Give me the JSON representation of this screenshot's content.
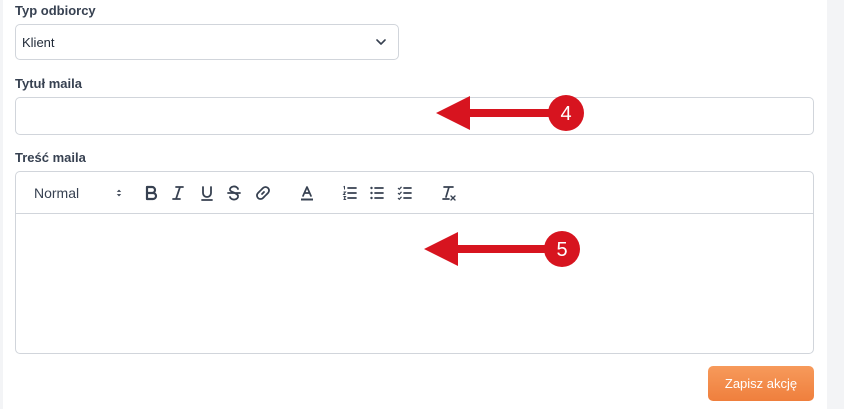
{
  "form": {
    "recipient_type_label": "Typ odbiorcy",
    "recipient_type_value": "Klient",
    "email_title_label": "Tytuł maila",
    "email_title_value": "",
    "email_body_label": "Treść maila",
    "toolbar": {
      "heading_value": "Normal",
      "icons": [
        "bold-icon",
        "italic-icon",
        "underline-icon",
        "strikethrough-icon",
        "link-icon",
        "text-color-icon",
        "ordered-list-icon",
        "bullet-list-icon",
        "check-list-icon",
        "clear-format-icon"
      ]
    },
    "save_label": "Zapisz akcję"
  },
  "annotations": {
    "arrow_4_label": "4",
    "arrow_5_label": "5",
    "color": "#d7141f"
  },
  "colors": {
    "accent": "#f08a4b",
    "border": "#d1d5db",
    "background": "#f3f4f6"
  }
}
